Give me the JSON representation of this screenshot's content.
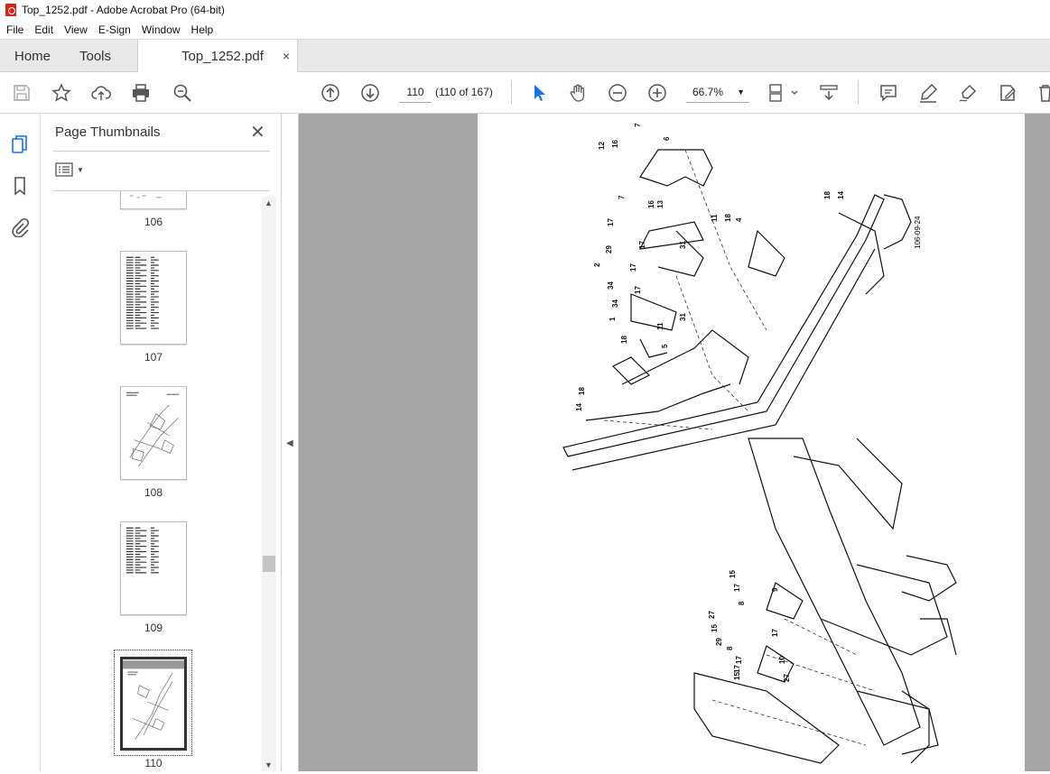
{
  "window": {
    "title": "Top_1252.pdf - Adobe Acrobat Pro (64-bit)"
  },
  "menu": [
    "File",
    "Edit",
    "View",
    "E-Sign",
    "Window",
    "Help"
  ],
  "tabs": {
    "home": "Home",
    "tools": "Tools",
    "doc": "Top_1252.pdf",
    "close": "×"
  },
  "toolbar": {
    "page_input": "110",
    "page_count": "(110 of 167)",
    "zoom": "66.7%"
  },
  "panel": {
    "title": "Page Thumbnails",
    "close": "✕"
  },
  "thumbnails": [
    {
      "label": "106"
    },
    {
      "label": "107"
    },
    {
      "label": "108"
    },
    {
      "label": "109"
    },
    {
      "label": "110"
    }
  ],
  "drawing": {
    "doc_code": "106-09-24",
    "callouts": [
      "7",
      "6",
      "12",
      "16",
      "7",
      "16",
      "13",
      "18",
      "14",
      "17",
      "11",
      "18",
      "4",
      "29",
      "17",
      "31",
      "2",
      "17",
      "34",
      "17",
      "34",
      "1",
      "11",
      "31",
      "18",
      "5",
      "14",
      "18",
      "15",
      "17",
      "8",
      "9",
      "17",
      "27",
      "15",
      "29",
      "8",
      "17",
      "17",
      "10",
      "15",
      "27"
    ]
  },
  "colors": {
    "accent": "#1473e6",
    "pdf_red": "#d4271c",
    "doc_bg": "#a5a5a5"
  }
}
